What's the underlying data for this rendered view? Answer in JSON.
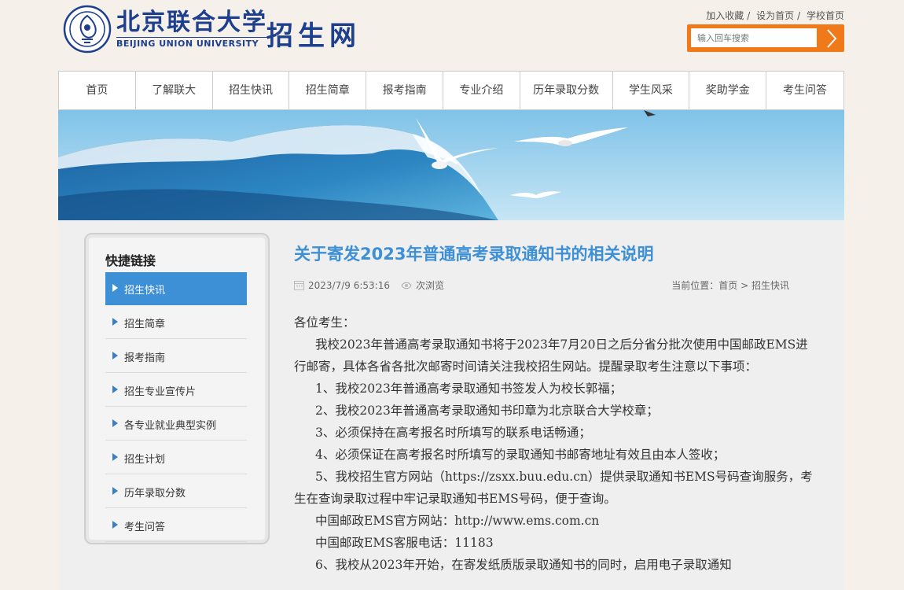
{
  "header": {
    "logo_cn": "北京联合大学",
    "logo_en": "BEIJING UNION UNIVERSITY",
    "site_name": "招生网",
    "top_links": [
      "加入收藏",
      "设为首页",
      "学校首页"
    ],
    "search_placeholder": "输入回车搜索"
  },
  "nav": {
    "items": [
      "首页",
      "了解联大",
      "招生快讯",
      "招生简章",
      "报考指南",
      "专业介绍",
      "历年录取分数",
      "学生风采",
      "奖助学金",
      "考生问答"
    ]
  },
  "sidebar": {
    "title": "快捷链接",
    "items": [
      "招生快讯",
      "招生简章",
      "报考指南",
      "招生专业宣传片",
      "各专业就业典型实例",
      "招生计划",
      "历年录取分数",
      "考生问答"
    ],
    "active_index": 0
  },
  "article": {
    "title": "关于寄发2023年普通高考录取通知书的相关说明",
    "date": "2023/7/9 6:53:16",
    "views": "次浏览",
    "location_label": "当前位置：",
    "crumb_home": "首页",
    "crumb_sep": ">",
    "crumb_current": "招生快讯",
    "paragraphs": [
      "各位考生：",
      "我校2023年普通高考录取通知书将于2023年7月20日之后分省分批次使用中国邮政EMS进行邮寄，具体各省各批次邮寄时间请关注我校招生网站。提醒录取考生注意以下事项：",
      "1、我校2023年普通高考录取通知书签发人为校长郭福；",
      "2、我校2023年普通高考录取通知书印章为北京联合大学校章；",
      "3、必须保持在高考报名时所填写的联系电话畅通；",
      "4、必须保证在高考报名时所填写的录取通知书邮寄地址有效且由本人签收；",
      "5、我校招生官方网站（https://zsxx.buu.edu.cn）提供录取通知书EMS号码查询服务，考生在查询录取过程中牢记录取通知书EMS号码，便于查询。",
      "中国邮政EMS官方网站：http://www.ems.com.cn",
      "中国邮政EMS客服电话：11183",
      "6、我校从2023年开始，在寄发纸质版录取通知书的同时，启用电子录取通知"
    ]
  },
  "colors": {
    "brand_blue": "#1d3f8e",
    "accent_blue": "#3d8fd6",
    "search_orange": "#f07a1a"
  }
}
